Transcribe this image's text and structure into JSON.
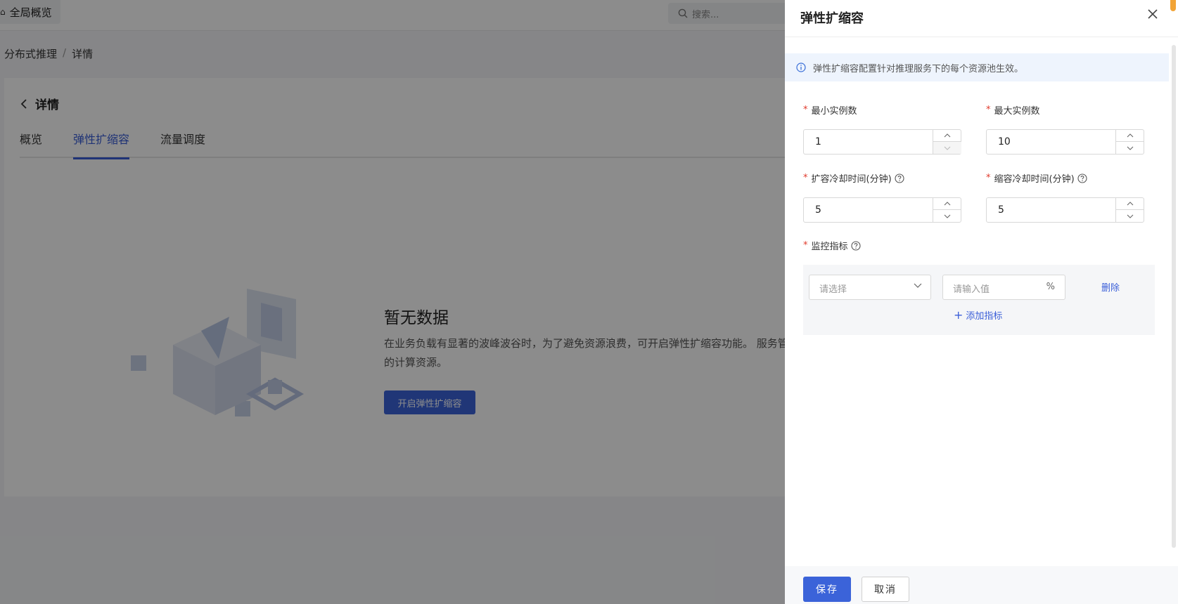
{
  "header": {
    "home_label": "全局概览",
    "home_icon": "home-icon",
    "search_placeholder": "搜索..."
  },
  "breadcrumb": {
    "items": [
      "分布式推理",
      "详情"
    ],
    "separator": "/"
  },
  "detail": {
    "back_icon": "chevron-left-icon",
    "title": "详情",
    "tabs": [
      {
        "label": "概览",
        "active": false
      },
      {
        "label": "弹性扩缩容",
        "active": true
      },
      {
        "label": "流量调度",
        "active": false
      }
    ]
  },
  "empty_state": {
    "title": "暂无数据",
    "description": "在业务负载有显著的波峰波谷时，为了避免资源浪费，可开启弹性扩缩容功能。 服务管理线上服务的计算资源。",
    "button_label": "开启弹性扩缩容"
  },
  "drawer": {
    "title": "弹性扩缩容",
    "info": "弹性扩缩容配置针对推理服务下的每个资源池生效。",
    "fields": {
      "min_instances": {
        "label": "最小实例数",
        "value": "1"
      },
      "max_instances": {
        "label": "最大实例数",
        "value": "10"
      },
      "scale_out_cooldown": {
        "label": "扩容冷却时间(分钟)",
        "value": "5"
      },
      "scale_in_cooldown": {
        "label": "缩容冷却时间(分钟)",
        "value": "5"
      }
    },
    "required_mark": "*",
    "monitor": {
      "label": "监控指标",
      "select_placeholder": "请选择",
      "value_placeholder": "请输入值",
      "unit": "%",
      "delete_label": "删除",
      "add_label": "添加指标"
    },
    "footer": {
      "save_label": "保存",
      "cancel_label": "取消"
    }
  },
  "colors": {
    "primary": "#3b63d9",
    "required": "#e0392b",
    "info_bg": "#eef4fd",
    "scroll_marker": "#f2a436"
  }
}
